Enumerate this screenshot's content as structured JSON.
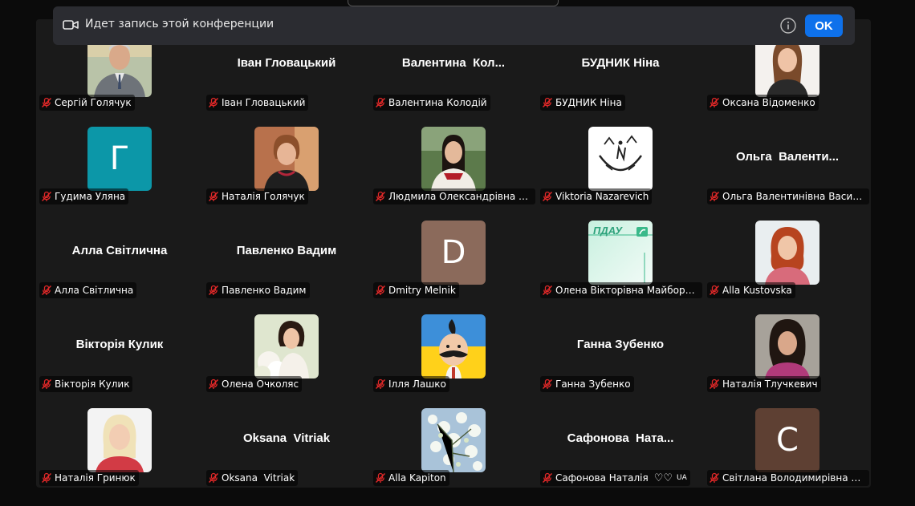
{
  "banner": {
    "text": "Идет запись этой конференции",
    "ok_label": "OK",
    "icons": [
      "video-record-icon",
      "info-icon"
    ]
  },
  "colors": {
    "accent": "#0e71eb",
    "tile_bg": "#1a1a1a",
    "mic_muted": "#e02828",
    "banner_bg": "#2b2c31"
  },
  "participants": [
    {
      "label": "Сергій Голячук",
      "display": "photo",
      "photo": "man-grey-suit"
    },
    {
      "label": "Іван Гловацький",
      "display": "name",
      "display_name": "Іван Гловацький"
    },
    {
      "label": "Валентина Колодій",
      "display": "name",
      "display_name": "Валентина  Кол..."
    },
    {
      "label": "БУДНИК Ніна",
      "display": "name",
      "display_name": "БУДНИК Ніна"
    },
    {
      "label": "Оксана Відоменко",
      "display": "photo",
      "photo": "woman-white-bg"
    },
    {
      "label": "Гудима Уляна",
      "display": "initial",
      "initial": "Г",
      "avatar_color": "#0c97a8"
    },
    {
      "label": "Наталія Голячук",
      "display": "photo",
      "photo": "woman-short-hair"
    },
    {
      "label": "Людмила Олександрівна Чи...",
      "display": "photo",
      "photo": "woman-embroidered"
    },
    {
      "label": "Viktoria Nazarevich",
      "display": "photo",
      "photo": "sketch-logo"
    },
    {
      "label": "Ольга Валентинівна Василен...",
      "display": "name",
      "display_name": "Ольга  Валенти..."
    },
    {
      "label": "Алла Світлична",
      "display": "name",
      "display_name": "Алла Світлична"
    },
    {
      "label": "Павленко Вадим",
      "display": "name",
      "display_name": "Павленко Вадим"
    },
    {
      "label": "Dmitry Melnik",
      "display": "initial",
      "initial": "D",
      "avatar_color": "#8b6a5b"
    },
    {
      "label": "Олена Вікторівна Майборода",
      "display": "photo",
      "photo": "pdau-logo",
      "logo_text": "ПДАУ"
    },
    {
      "label": "Alla Kustovska",
      "display": "photo",
      "photo": "woman-red-hair"
    },
    {
      "label": "Вікторія Кулик",
      "display": "name",
      "display_name": "Вікторія Кулик"
    },
    {
      "label": "Олена Очколяс",
      "display": "photo",
      "photo": "woman-flowers"
    },
    {
      "label": "Ілля Лашко",
      "display": "photo",
      "photo": "cossack-cartoon"
    },
    {
      "label": "Ганна Зубенко",
      "display": "name",
      "display_name": "Ганна Зубенко"
    },
    {
      "label": "Наталія Тлучкевич",
      "display": "photo",
      "photo": "woman-dark-hair"
    },
    {
      "label": "Наталія Гринюк",
      "display": "photo",
      "photo": "woman-blonde"
    },
    {
      "label": "Oksana  Vitriak",
      "display": "name",
      "display_name": "Oksana  Vitriak"
    },
    {
      "label": "Alla Kapiton",
      "display": "photo",
      "photo": "blossom-tree"
    },
    {
      "label": "Сафонова Наталія",
      "display": "name",
      "display_name": "Сафонова  Ната...",
      "label_extra": "UA"
    },
    {
      "label": "Світлана Володимирівна Ме...",
      "display": "initial",
      "initial": "C",
      "avatar_color": "#5e4033"
    }
  ]
}
